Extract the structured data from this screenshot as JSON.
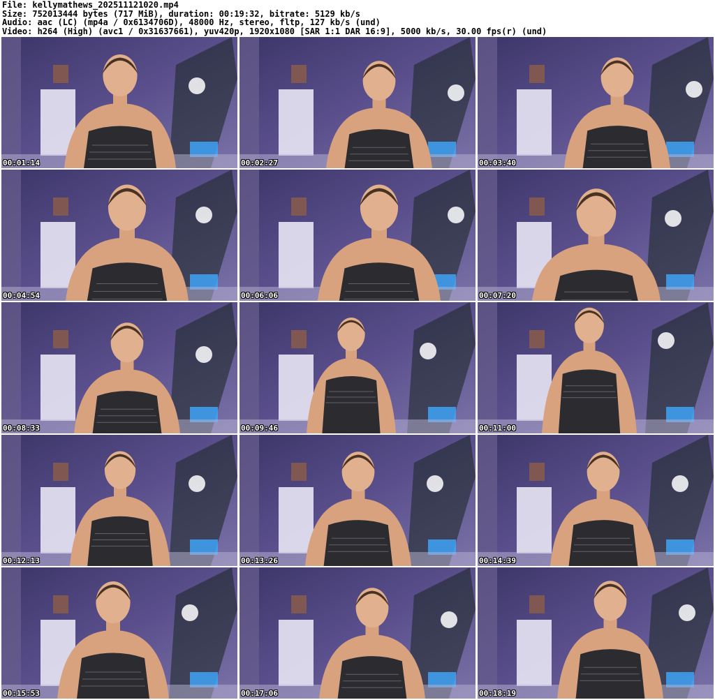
{
  "header": {
    "file_line": "File: kellymathews_202511121020.mp4",
    "size_line": "Size: 752013444 bytes (717 MiB), duration: 00:19:32, bitrate: 5129 kb/s",
    "audio_line": "Audio: aac (LC) (mp4a / 0x6134706D), 48000 Hz, stereo, fltp, 127 kb/s (und)",
    "video_line": "Video: h264 (High) (avc1 / 0x31637661), yuv420p, 1920x1080 [SAR 1:1 DAR 16:9], 5000 kb/s, 30.00 fps(r) (und)"
  },
  "thumbnails": [
    {
      "timestamp": "00:01:14"
    },
    {
      "timestamp": "00:02:27"
    },
    {
      "timestamp": "00:03:40"
    },
    {
      "timestamp": "00:04:54"
    },
    {
      "timestamp": "00:06:06"
    },
    {
      "timestamp": "00:07:20"
    },
    {
      "timestamp": "00:08:33"
    },
    {
      "timestamp": "00:09:46"
    },
    {
      "timestamp": "00:11:00"
    },
    {
      "timestamp": "00:12:13"
    },
    {
      "timestamp": "00:13:26"
    },
    {
      "timestamp": "00:14:39"
    },
    {
      "timestamp": "00:15:53"
    },
    {
      "timestamp": "00:17:06"
    },
    {
      "timestamp": "00:18:19"
    }
  ],
  "colors": {
    "background": "#ffffff",
    "room_purple": "#5a4f8c",
    "room_dark": "#2a2540",
    "neon_blue": "#3fa9ff",
    "skin": "#d9a27f",
    "top": "#2b2b30"
  }
}
